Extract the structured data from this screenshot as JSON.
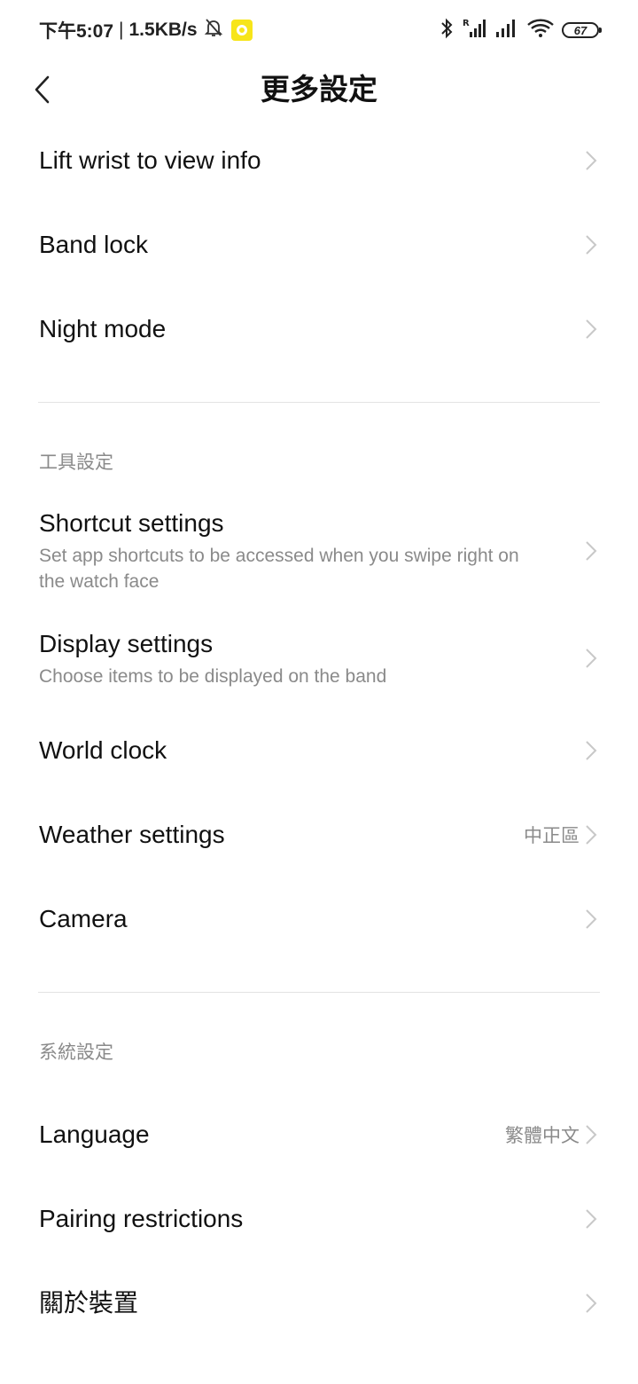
{
  "status_bar": {
    "time": "下午5:07",
    "network_speed": "1.5KB/s",
    "battery_level": "67",
    "icons": [
      "mute-bell-icon",
      "app-notification-icon",
      "bluetooth-icon",
      "signal-roaming-icon",
      "signal-icon",
      "wifi-icon",
      "battery-icon"
    ]
  },
  "header": {
    "title": "更多設定",
    "back_icon": "chevron-left-icon"
  },
  "sections": {
    "top": {
      "items": [
        {
          "label": "Lift wrist to view info"
        },
        {
          "label": "Band lock"
        },
        {
          "label": "Night mode"
        }
      ]
    },
    "tools": {
      "title": "工具設定",
      "items": [
        {
          "label": "Shortcut settings",
          "description": "Set app shortcuts to be accessed when you swipe right on the watch face"
        },
        {
          "label": "Display settings",
          "description": "Choose items to be displayed on the band"
        },
        {
          "label": "World clock"
        },
        {
          "label": "Weather settings",
          "value": "中正區"
        },
        {
          "label": "Camera"
        }
      ]
    },
    "system": {
      "title": "系統設定",
      "items": [
        {
          "label": "Language",
          "value": "繁體中文"
        },
        {
          "label": "Pairing restrictions"
        },
        {
          "label": "關於裝置"
        }
      ]
    }
  },
  "colors": {
    "background": "#ffffff",
    "text_primary": "#111111",
    "text_secondary": "#8a8a8a",
    "divider": "#e3e3e3",
    "chevron": "#c8c8c8",
    "notification_app": "#f7e51a"
  }
}
